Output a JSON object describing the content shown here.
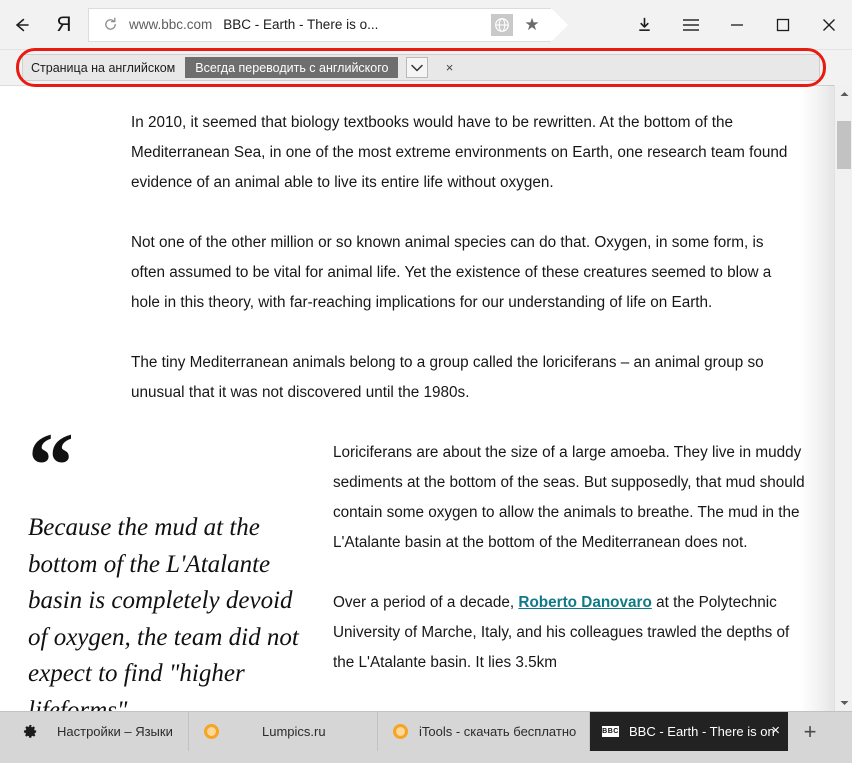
{
  "browser": {
    "back_label": "Back",
    "logo_label": "Я",
    "reload_label": "Reload",
    "url_host": "www.bbc.com",
    "url_title": "BBC - Earth - There is o...",
    "translate_icon": "globe-translate-icon",
    "bookmark_icon": "star-icon",
    "download_icon": "download-icon",
    "menu_icon": "hamburger-menu-icon",
    "minimize_icon": "minimize-icon",
    "maximize_icon": "maximize-icon",
    "close_icon": "close-icon"
  },
  "translate_bar": {
    "status_text": "Страница на английском",
    "action_label": "Всегда переводить с английского",
    "dropdown_icon": "chevron-down-icon",
    "close_label": "×",
    "highlight_color": "#e81b11"
  },
  "page": {
    "paragraphs": [
      "In 2010, it seemed that biology textbooks would have to be rewritten. At the bottom of the Mediterranean Sea, in one of the most extreme environments on Earth, one research team found evidence of an animal able to live its entire life without oxygen.",
      "Not one of the other million or so known animal species can do that. Oxygen, in some form, is often assumed to be vital for animal life. Yet the existence of these creatures seemed to blow a hole in this theory, with far-reaching implications for our understanding of life on Earth.",
      "The tiny Mediterranean animals belong to a group called the loriciferans – an animal group so unusual that it was not discovered until the 1980s."
    ],
    "pullquote": {
      "mark": "“",
      "text": "Because the mud at the bottom of the L'Atalante basin is completely devoid of oxygen, the team did not expect to find \"higher lifeforms\""
    },
    "column": {
      "paragraph_1": "Loriciferans are about the size of a large amoeba. They live in muddy sediments at the bottom of the seas. But supposedly, that mud should contain some oxygen to allow the animals to breathe. The mud in the L'Atalante basin at the bottom of the Mediterranean does not.",
      "paragraph_2_before": "Over a period of a decade, ",
      "paragraph_2_link": "Roberto Danovaro",
      "paragraph_2_after": " at the Polytechnic University of Marche, Italy, and his colleagues trawled the depths of the L'Atalante basin. It lies 3.5km",
      "link_color": "#0f7a86"
    }
  },
  "scrollbar": {
    "up_icon": "scroll-up-arrow-icon",
    "down_icon": "scroll-down-arrow-icon",
    "thumb": "scrollbar-thumb"
  },
  "taskbar": {
    "tabs": [
      {
        "icon": "gear-icon",
        "title": "Настройки – Языки",
        "active": false
      },
      {
        "icon": "orange-favicon",
        "title": "Lumpics.ru",
        "active": false
      },
      {
        "icon": "orange-favicon",
        "title": "iTools - скачать бесплатно",
        "active": false
      },
      {
        "icon": "bbc-favicon",
        "favicon_text": "BBC",
        "title": "BBC - Earth - There is on",
        "active": true,
        "close_label": "×"
      }
    ],
    "new_tab_label": "+"
  }
}
